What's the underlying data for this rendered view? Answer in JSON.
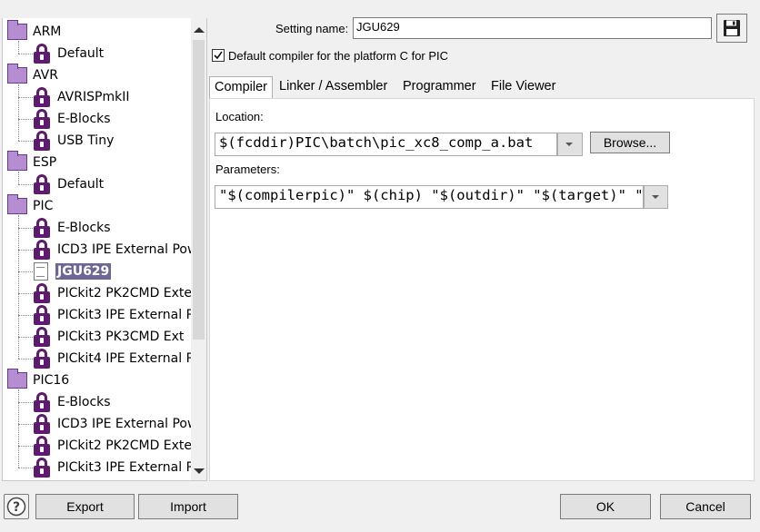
{
  "tree": {
    "groups": [
      {
        "label": "ARM",
        "items": [
          {
            "label": "Default",
            "icon": "lock-icon"
          }
        ]
      },
      {
        "label": "AVR",
        "items": [
          {
            "label": "AVRISPmkII",
            "icon": "lock-icon"
          },
          {
            "label": "E-Blocks",
            "icon": "lock-icon"
          },
          {
            "label": "USB Tiny",
            "icon": "lock-icon"
          }
        ]
      },
      {
        "label": "ESP",
        "items": [
          {
            "label": "Default",
            "icon": "lock-icon"
          }
        ]
      },
      {
        "label": "PIC",
        "items": [
          {
            "label": "E-Blocks",
            "icon": "lock-icon"
          },
          {
            "label": "ICD3 IPE External Pow",
            "icon": "lock-icon"
          },
          {
            "label": "JGU629",
            "icon": "document-icon",
            "selected": true
          },
          {
            "label": "PICkit2 PK2CMD Exter",
            "icon": "lock-icon"
          },
          {
            "label": "PICkit3 IPE External P",
            "icon": "lock-icon"
          },
          {
            "label": "PICkit3 PK3CMD Ext",
            "icon": "lock-icon"
          },
          {
            "label": "PICkit4 IPE External P",
            "icon": "lock-icon"
          }
        ]
      },
      {
        "label": "PIC16",
        "items": [
          {
            "label": "E-Blocks",
            "icon": "lock-icon"
          },
          {
            "label": "ICD3 IPE External Pow",
            "icon": "lock-icon"
          },
          {
            "label": "PICkit2 PK2CMD Exter",
            "icon": "lock-icon"
          },
          {
            "label": "PICkit3 IPE External P",
            "icon": "lock-icon"
          }
        ]
      }
    ]
  },
  "setting": {
    "name_label": "Setting name:",
    "name_value": "JGU629",
    "save_icon": "floppy-disk-icon",
    "default_checkbox_label": "Default compiler for the platform C for PIC",
    "default_checked": true
  },
  "tabs": [
    {
      "label": "Compiler",
      "active": true
    },
    {
      "label": "Linker / Assembler"
    },
    {
      "label": "Programmer"
    },
    {
      "label": "File Viewer"
    }
  ],
  "compiler": {
    "location_label": "Location:",
    "location_value": "$(fcddir)PIC\\batch\\pic_xc8_comp_a.bat",
    "browse_label": "Browse...",
    "parameters_label": "Parameters:",
    "parameters_value": "\"$(compilerpic)\" $(chip) \"$(outdir)\" \"$(target)\" \"$(outdir)"
  },
  "footer": {
    "help_icon": "help-icon",
    "export_label": "Export",
    "import_label": "Import",
    "ok_label": "OK",
    "cancel_label": "Cancel"
  }
}
